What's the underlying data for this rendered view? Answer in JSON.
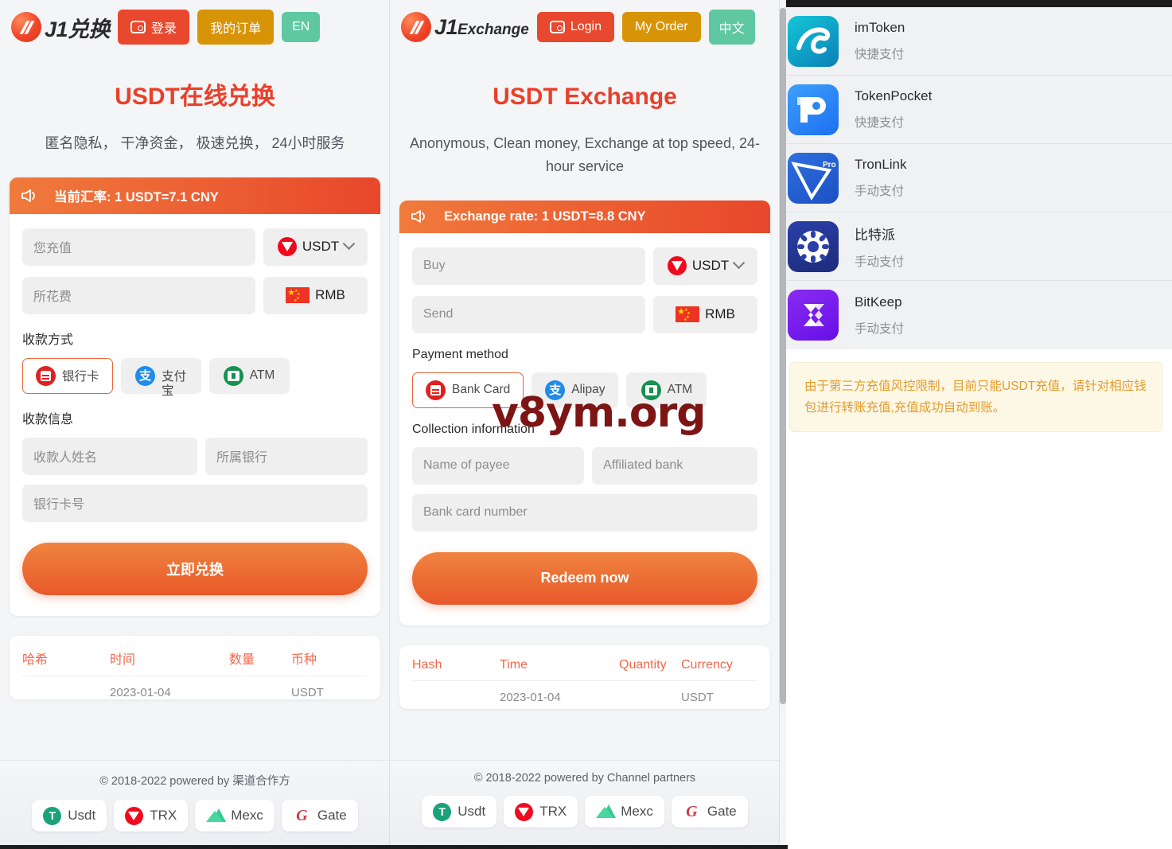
{
  "watermark": "v8ym.org",
  "colors": {
    "brand_red": "#e8402a",
    "login_btn": "#e8482d",
    "order_btn": "#d89407",
    "lang_btn": "#5fc8a2",
    "rate_bar_start": "#f07a3c",
    "rate_bar_end": "#e8472b",
    "notice_text": "#e39c2c",
    "table_header": "#f2674a",
    "watermark": "#7d1515"
  },
  "panels": [
    {
      "lang": "zh",
      "header": {
        "logo_text": "J1兑换",
        "logo_suffix": "",
        "login_label": "登录",
        "order_label": "我的订单",
        "lang_label": "EN",
        "wallet_icon": "wallet-icon"
      },
      "hero": {
        "title": "USDT在线兑换",
        "subtitle": "匿名隐私， 干净资金， 极速兑换， 24小时服务"
      },
      "card": {
        "rate_text": "当前汇率: 1 USDT=7.1 CNY",
        "horn_icon": "megaphone-icon",
        "buy_placeholder": "您充值",
        "buy_currency": "USDT",
        "send_placeholder": "所花费",
        "send_currency": "RMB",
        "payment_label": "收款方式",
        "payment_methods": [
          {
            "label": "银行卡",
            "icon": "bank-card-icon",
            "active": true
          },
          {
            "label": "支付",
            "overflow": "宝",
            "icon": "alipay-icon",
            "active": false
          },
          {
            "label": "ATM",
            "icon": "atm-icon",
            "active": false
          }
        ],
        "collection_label": "收款信息",
        "payee_placeholder": "收款人姓名",
        "bank_placeholder": "所属银行",
        "cardno_placeholder": "银行卡号",
        "submit_label": "立即兑换"
      },
      "table": {
        "headers": [
          "哈希",
          "时间",
          "数量",
          "币种"
        ],
        "rows": [
          [
            "",
            "2023-01-04",
            "",
            "USDT"
          ]
        ]
      },
      "footer": {
        "copyright": "© 2018-2022 powered by 渠道合作方",
        "partners": [
          {
            "label": "Usdt",
            "icon": "usdt-icon"
          },
          {
            "label": "TRX",
            "icon": "trx-icon"
          },
          {
            "label": "Mexc",
            "icon": "mexc-icon"
          },
          {
            "label": "Gate",
            "icon": "gate-icon"
          }
        ]
      }
    },
    {
      "lang": "en",
      "header": {
        "logo_text": "J1",
        "logo_suffix": "Exchange",
        "login_label": "Login",
        "order_label": "My Order",
        "lang_label": "中文",
        "wallet_icon": "wallet-icon"
      },
      "hero": {
        "title": "USDT Exchange",
        "subtitle": "Anonymous, Clean money, Exchange at top speed, 24-hour service"
      },
      "card": {
        "rate_text": "Exchange rate: 1 USDT=8.8 CNY",
        "horn_icon": "megaphone-icon",
        "buy_placeholder": "Buy",
        "buy_currency": "USDT",
        "send_placeholder": "Send",
        "send_currency": "RMB",
        "payment_label": "Payment method",
        "payment_methods": [
          {
            "label": "Bank Card",
            "icon": "bank-card-icon",
            "active": true
          },
          {
            "label": "Alipay",
            "overflow": "",
            "icon": "alipay-icon",
            "active": false
          },
          {
            "label": "ATM",
            "icon": "atm-icon",
            "active": false
          }
        ],
        "collection_label": "Collection information",
        "payee_placeholder": "Name of payee",
        "bank_placeholder": "Affiliated bank",
        "cardno_placeholder": "Bank card number",
        "submit_label": "Redeem now"
      },
      "table": {
        "headers": [
          "Hash",
          "Time",
          "Quantity",
          "Currency"
        ],
        "rows": [
          [
            "",
            "2023-01-04",
            "",
            "USDT"
          ]
        ]
      },
      "footer": {
        "copyright": "© 2018-2022 powered by Channel partners",
        "partners": [
          {
            "label": "Usdt",
            "icon": "usdt-icon"
          },
          {
            "label": "TRX",
            "icon": "trx-icon"
          },
          {
            "label": "Mexc",
            "icon": "mexc-icon"
          },
          {
            "label": "Gate",
            "icon": "gate-icon"
          }
        ]
      }
    }
  ],
  "wallet_panel": {
    "items": [
      {
        "name": "imToken",
        "sub": "快捷支付",
        "icon": "imtoken-icon"
      },
      {
        "name": "TokenPocket",
        "sub": "快捷支付",
        "icon": "tokenpocket-icon"
      },
      {
        "name": "TronLink",
        "sub": "手动支付",
        "icon": "tronlink-icon"
      },
      {
        "name": "比特派",
        "sub": "手动支付",
        "icon": "bitpie-icon"
      },
      {
        "name": "BitKeep",
        "sub": "手动支付",
        "icon": "bitkeep-icon"
      }
    ],
    "notice": "由于第三方充值风控限制，目前只能USDT充值，请针对相应钱包进行转账充值,充值成功自动到账。"
  }
}
